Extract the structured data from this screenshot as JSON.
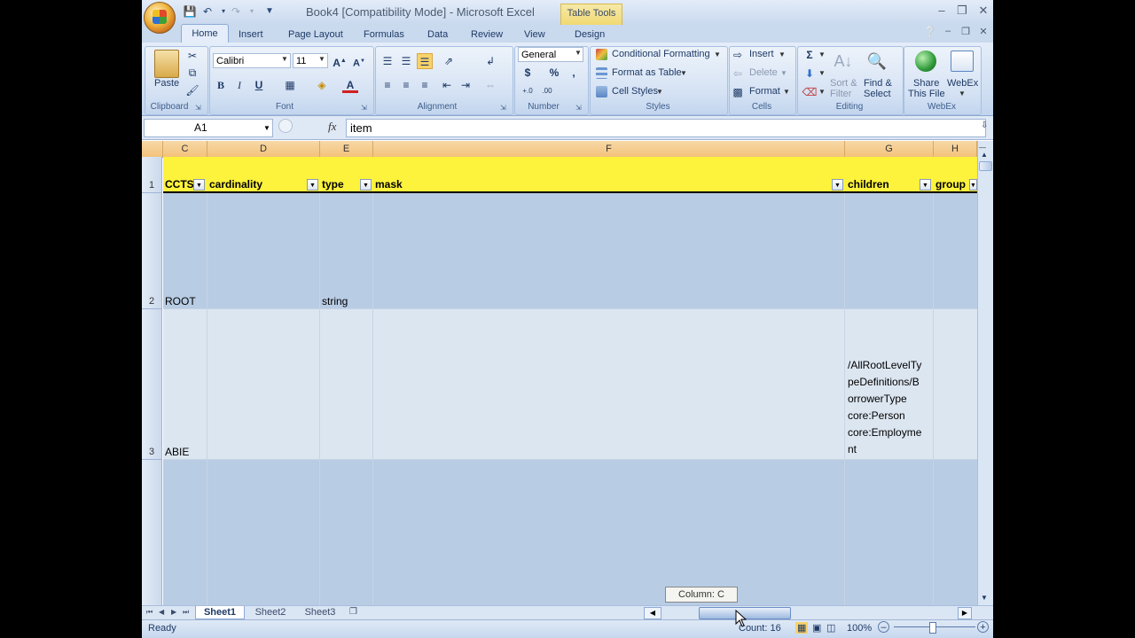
{
  "window": {
    "title": "Book4  [Compatibility Mode] - Microsoft Excel",
    "contextual_tab": "Table Tools"
  },
  "tabs": [
    "Home",
    "Insert",
    "Page Layout",
    "Formulas",
    "Data",
    "Review",
    "View",
    "Design"
  ],
  "ribbon": {
    "clipboard": {
      "label": "Clipboard",
      "paste": "Paste"
    },
    "font": {
      "label": "Font",
      "name": "Calibri",
      "size": "11"
    },
    "alignment": {
      "label": "Alignment"
    },
    "number": {
      "label": "Number",
      "format": "General"
    },
    "styles": {
      "label": "Styles",
      "conditional": "Conditional Formatting",
      "format_table": "Format as Table",
      "cell_styles": "Cell Styles"
    },
    "cells": {
      "label": "Cells",
      "insert": "Insert",
      "delete": "Delete",
      "format": "Format"
    },
    "editing": {
      "label": "Editing",
      "sort_filter_1": "Sort &",
      "sort_filter_2": "Filter",
      "find_select_1": "Find &",
      "find_select_2": "Select"
    },
    "webex": {
      "label": "WebEx",
      "share_1": "Share",
      "share_2": "This File",
      "webex": "WebEx"
    }
  },
  "formula_bar": {
    "name_box": "A1",
    "fx": "fx",
    "value": "item"
  },
  "columns": [
    "C",
    "D",
    "E",
    "F",
    "G",
    "H"
  ],
  "rows": [
    {
      "num": "1",
      "cells": [
        "CCTS",
        "cardinality",
        "type",
        "mask",
        "children",
        "group"
      ]
    },
    {
      "num": "2",
      "cells": [
        "ROOT",
        "",
        "string",
        "",
        "",
        ""
      ]
    },
    {
      "num": "3",
      "cells": [
        "ABIE",
        "",
        "",
        "",
        "/AllRootLevelTy|peDefinitions/B|orrowerType|core:Person|core:Employme|nt",
        ""
      ]
    }
  ],
  "sheets": [
    "Sheet1",
    "Sheet2",
    "Sheet3"
  ],
  "tooltip": "Column: C",
  "status": {
    "ready": "Ready",
    "count": "Count: 16",
    "zoom": "100%"
  }
}
